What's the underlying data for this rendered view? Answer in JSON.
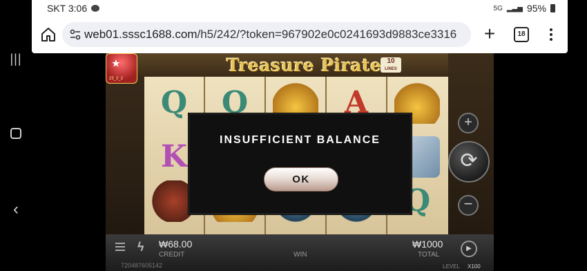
{
  "status_bar": {
    "carrier_time": "SKT 3:06",
    "network_badge": "5G",
    "battery": "95%"
  },
  "browser": {
    "url_host": "web01.sssc1688.com",
    "url_path": "/h5/242/?token=967902e0c0241693d9883ce3316",
    "tab_count": "18",
    "icons": [
      "home-icon",
      "tune-icon",
      "plus-icon",
      "tabs-icon",
      "more-icon"
    ]
  },
  "game": {
    "title": "Treasure Pirate",
    "lines_number": "10",
    "lines_label": "LINES",
    "promo_badge_text": "23_2_2",
    "credit_value": "₩68.00",
    "credit_label": "CREDIT",
    "win_label": "WIN",
    "total_value": "₩1000",
    "total_label": "TOTAL",
    "game_id": "720487605142",
    "level_label": "LEVEL",
    "level_value": "X100"
  },
  "modal": {
    "message": "INSUFFICIENT BALANCE",
    "ok_label": "OK"
  },
  "colors": {
    "modal_bg": "#101010",
    "title_gold": "#e6c45a",
    "chrome_bg": "#ffffff",
    "url_bar_bg": "#eef0f5"
  }
}
